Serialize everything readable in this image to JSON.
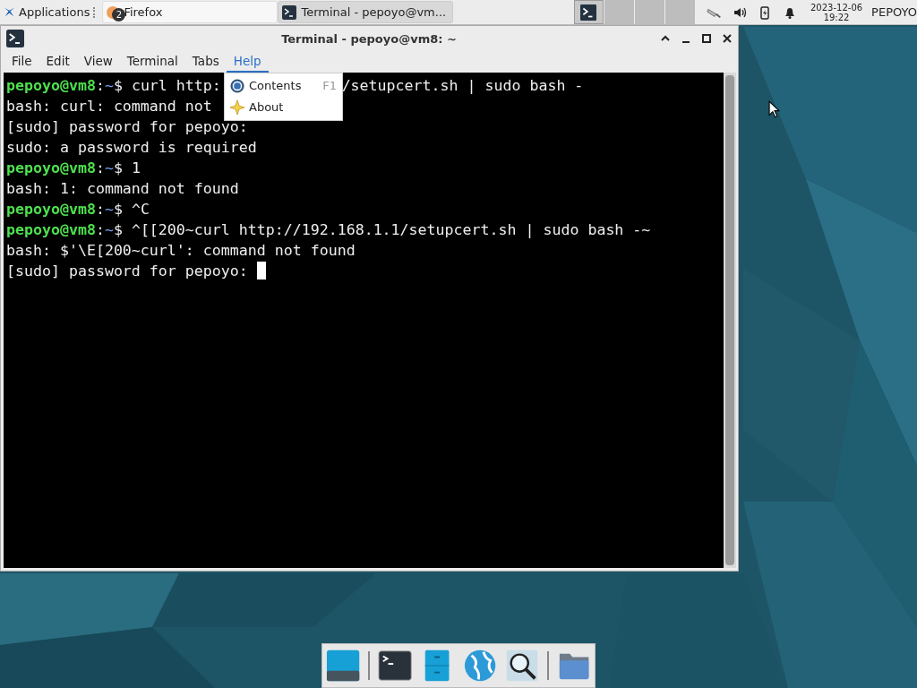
{
  "panel": {
    "apps_button": "Applications",
    "tasks": [
      {
        "title": "Firefox",
        "badge": "2",
        "selected": false
      },
      {
        "title": "Terminal - pepoyo@vm...",
        "selected": true
      }
    ],
    "workspaces": [
      {
        "selected": true
      },
      {
        "selected": false
      },
      {
        "selected": false
      },
      {
        "selected": false
      }
    ],
    "clock": {
      "date": "2023-12-06",
      "time": "19:22"
    },
    "user": "PEPOYO"
  },
  "window": {
    "title": "Terminal - pepoyo@vm8: ~",
    "menu": [
      {
        "label": "File",
        "selected": false
      },
      {
        "label": "Edit",
        "selected": false
      },
      {
        "label": "View",
        "selected": false
      },
      {
        "label": "Terminal",
        "selected": false
      },
      {
        "label": "Tabs",
        "selected": false
      },
      {
        "label": "Help",
        "selected": true
      }
    ],
    "help_menu": [
      {
        "label": "Contents",
        "shortcut": "F1",
        "kind": "help"
      },
      {
        "label": "About",
        "kind": "about"
      }
    ],
    "lines": [
      {
        "user": "pepoyo@vm8",
        "sep": ":",
        "path": "~",
        "sign": "$",
        "text": "curl http:",
        "tail": "/setupcert.sh | sudo bash -"
      },
      {
        "text": "bash: curl: command not"
      },
      {
        "text": "[sudo] password for pepoyo:"
      },
      {
        "text": "sudo: a password is required"
      },
      {
        "user": "pepoyo@vm8",
        "sep": ":",
        "path": "~",
        "sign": "$",
        "text": "1"
      },
      {
        "text": "bash: 1: command not found"
      },
      {
        "user": "pepoyo@vm8",
        "sep": ":",
        "path": "~",
        "sign": "$",
        "text": "^C"
      },
      {
        "user": "pepoyo@vm8",
        "sep": ":",
        "path": "~",
        "sign": "$",
        "text": "^[[200~curl http://192.168.1.1/setupcert.sh | sudo bash -~"
      },
      {
        "text": "bash: $'\\E[200~curl': command not found"
      },
      {
        "text": "[sudo] password for pepoyo: ",
        "cursor": true
      }
    ]
  }
}
